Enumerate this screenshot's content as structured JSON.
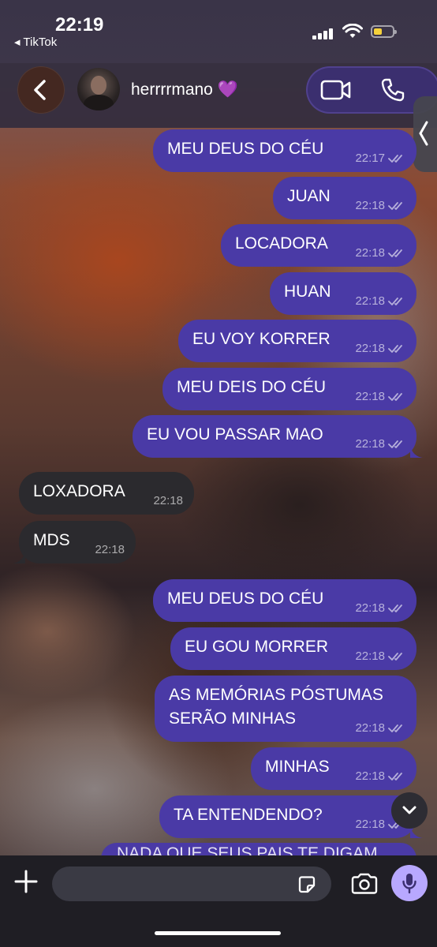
{
  "status": {
    "time": "22:19",
    "back_app": "◂ TikTok"
  },
  "header": {
    "contact_name": "herrrrmano 💜"
  },
  "colors": {
    "outgoing_bubble": "#4a3aa6",
    "incoming_bubble": "#2b2a2e",
    "accent_mic": "#b8a8ff",
    "battery": "#f5d13b"
  },
  "messages": [
    {
      "dir": "out",
      "text": "MEU DEUS DO CÉU",
      "time": "22:17"
    },
    {
      "dir": "out",
      "text": "JUAN",
      "time": "22:18"
    },
    {
      "dir": "out",
      "text": "LOCADORA",
      "time": "22:18"
    },
    {
      "dir": "out",
      "text": "HUAN",
      "time": "22:18"
    },
    {
      "dir": "out",
      "text": "EU VOY KORRER",
      "time": "22:18"
    },
    {
      "dir": "out",
      "text": "MEU DEIS DO CÉU",
      "time": "22:18"
    },
    {
      "dir": "out",
      "text": "EU VOU PASSAR MAO",
      "time": "22:18"
    },
    {
      "dir": "in",
      "text": "LOXADORA",
      "time": "22:18"
    },
    {
      "dir": "in",
      "text": "MDS",
      "time": "22:18"
    },
    {
      "dir": "out",
      "text": "MEU DEUS DO CÉU",
      "time": "22:18"
    },
    {
      "dir": "out",
      "text": "EU GOU MORRER",
      "time": "22:18"
    },
    {
      "dir": "out",
      "text": "AS MEMÓRIAS PÓSTUMAS SERÃO MINHAS",
      "time": "22:18"
    },
    {
      "dir": "out",
      "text": "MINHAS",
      "time": "22:18"
    },
    {
      "dir": "out",
      "text": "TA ENTENDENDO?",
      "time": "22:18"
    }
  ],
  "partial_message": "NADA QUE SEUS PAIS TE DIGAM",
  "composer": {
    "placeholder": ""
  },
  "icons": {
    "back": "chevron-left-icon",
    "video": "video-camera-icon",
    "phone": "phone-icon",
    "add": "plus-icon",
    "sticker": "sticker-icon",
    "camera": "camera-icon",
    "mic": "microphone-icon",
    "scroll": "chevron-down-icon",
    "read": "double-check-icon"
  }
}
